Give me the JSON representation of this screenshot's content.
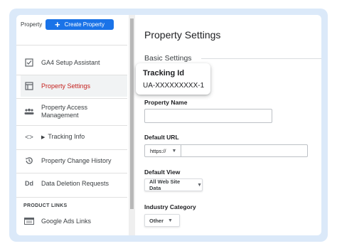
{
  "sidebar": {
    "property_label": "Property",
    "create_button": "Create Property",
    "items": [
      {
        "label": "GA4 Setup Assistant",
        "icon": "checkbox-icon"
      },
      {
        "label": "Property Settings",
        "icon": "settings-page-icon"
      },
      {
        "label": "Property Access Management",
        "icon": "people-icon"
      },
      {
        "label": "Tracking Info",
        "icon": "code-icon"
      },
      {
        "label": "Property Change History",
        "icon": "history-icon"
      },
      {
        "label": "Data Deletion Requests",
        "icon": "dd-icon"
      }
    ],
    "section_label": "PRODUCT LINKS",
    "links": [
      {
        "label": "Google Ads Links",
        "icon": "google-ads-icon"
      }
    ]
  },
  "main": {
    "title": "Property Settings",
    "section": "Basic Settings",
    "tracking": {
      "title": "Tracking Id",
      "value": "UA-XXXXXXXXX-1"
    },
    "property_name_label": "Property Name",
    "default_url_label": "Default URL",
    "default_url_protocol": "https://",
    "default_view_label": "Default View",
    "default_view_value": "All Web Site Data",
    "industry_label": "Industry Category",
    "industry_value": "Other"
  },
  "colors": {
    "accent": "#1a73e8",
    "active": "#c5221f",
    "frame": "#dbe9f9"
  }
}
